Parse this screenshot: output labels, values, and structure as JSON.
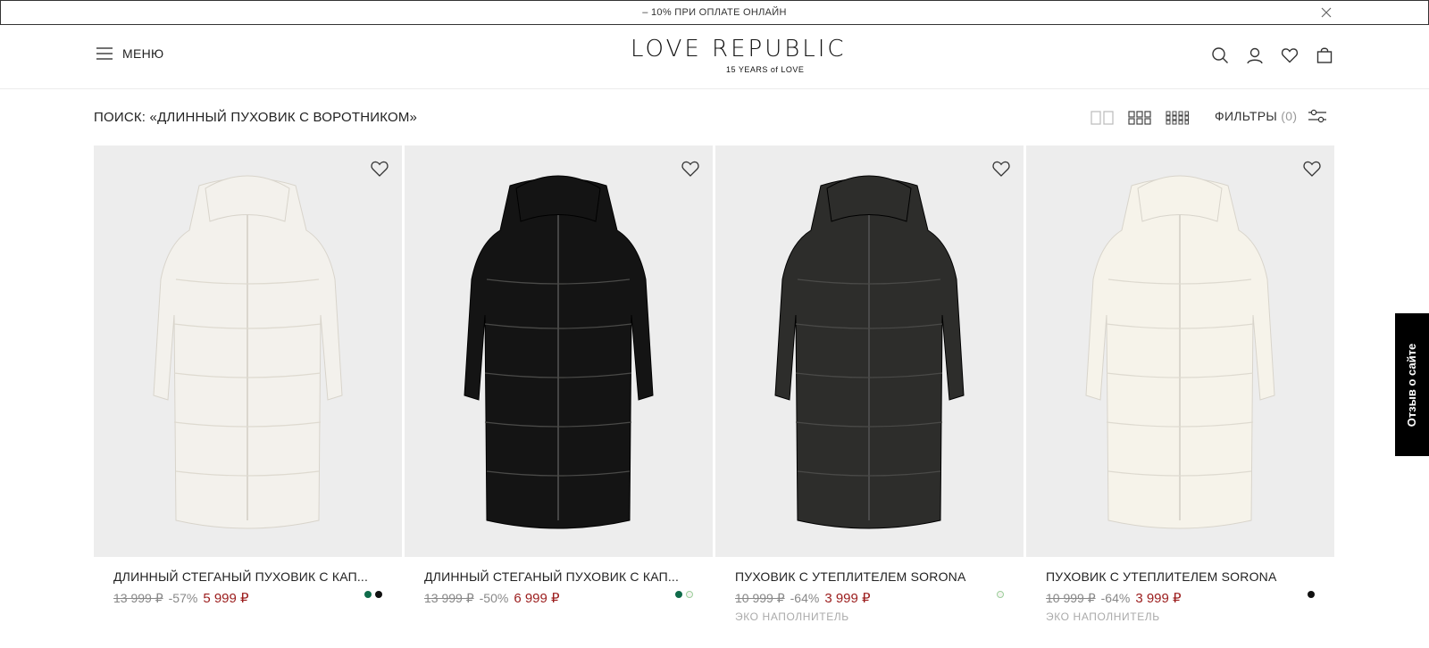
{
  "promo": {
    "text": "– 10% ПРИ ОПЛАТЕ ОНЛАЙН",
    "close_icon": "close-icon"
  },
  "header": {
    "menu_label": "МЕНЮ",
    "logo_main": "LOVE REPUBLIC",
    "logo_sub": "15 YEARS of LOVE",
    "icons": [
      "search-icon",
      "account-icon",
      "heart-icon",
      "bag-icon"
    ]
  },
  "search": {
    "title": "ПОИСК: «ДЛИННЫЙ ПУХОВИК С ВОРОТНИКОМ»"
  },
  "toolbar": {
    "grid_options": [
      "grid-2-icon",
      "grid-3-icon",
      "grid-4-icon"
    ],
    "filters_label": "ФИЛЬТРЫ",
    "filters_count": "(0)"
  },
  "products": [
    {
      "name": "ДЛИННЫЙ СТЕГАНЫЙ ПУХОВИК С КАП...",
      "old_price": "13 999 ₽",
      "discount": "-57%",
      "price": "5 999 ₽",
      "note": "",
      "swatches": [
        "#0f6b4a",
        "#111111"
      ],
      "coat_color": "#f3f1ec"
    },
    {
      "name": "ДЛИННЫЙ СТЕГАНЫЙ ПУХОВИК С КАП...",
      "old_price": "13 999 ₽",
      "discount": "-50%",
      "price": "6 999 ₽",
      "note": "",
      "swatches": [
        "#0f6b4a",
        "#f4f4f0"
      ],
      "coat_color": "#141414"
    },
    {
      "name": "ПУХОВИК С УТЕПЛИТЕЛЕМ SORONA",
      "old_price": "10 999 ₽",
      "discount": "-64%",
      "price": "3 999 ₽",
      "note": "ЭКО НАПОЛНИТЕЛЬ",
      "swatches": [
        "#f4f4f0"
      ],
      "coat_color": "#2d2d2b"
    },
    {
      "name": "ПУХОВИК С УТЕПЛИТЕЛЕМ SORONA",
      "old_price": "10 999 ₽",
      "discount": "-64%",
      "price": "3 999 ₽",
      "note": "ЭКО НАПОЛНИТЕЛЬ",
      "swatches": [
        "#111111"
      ],
      "coat_color": "#f6f3ea"
    }
  ],
  "feedback": {
    "label": "Отзыв о сайте"
  }
}
